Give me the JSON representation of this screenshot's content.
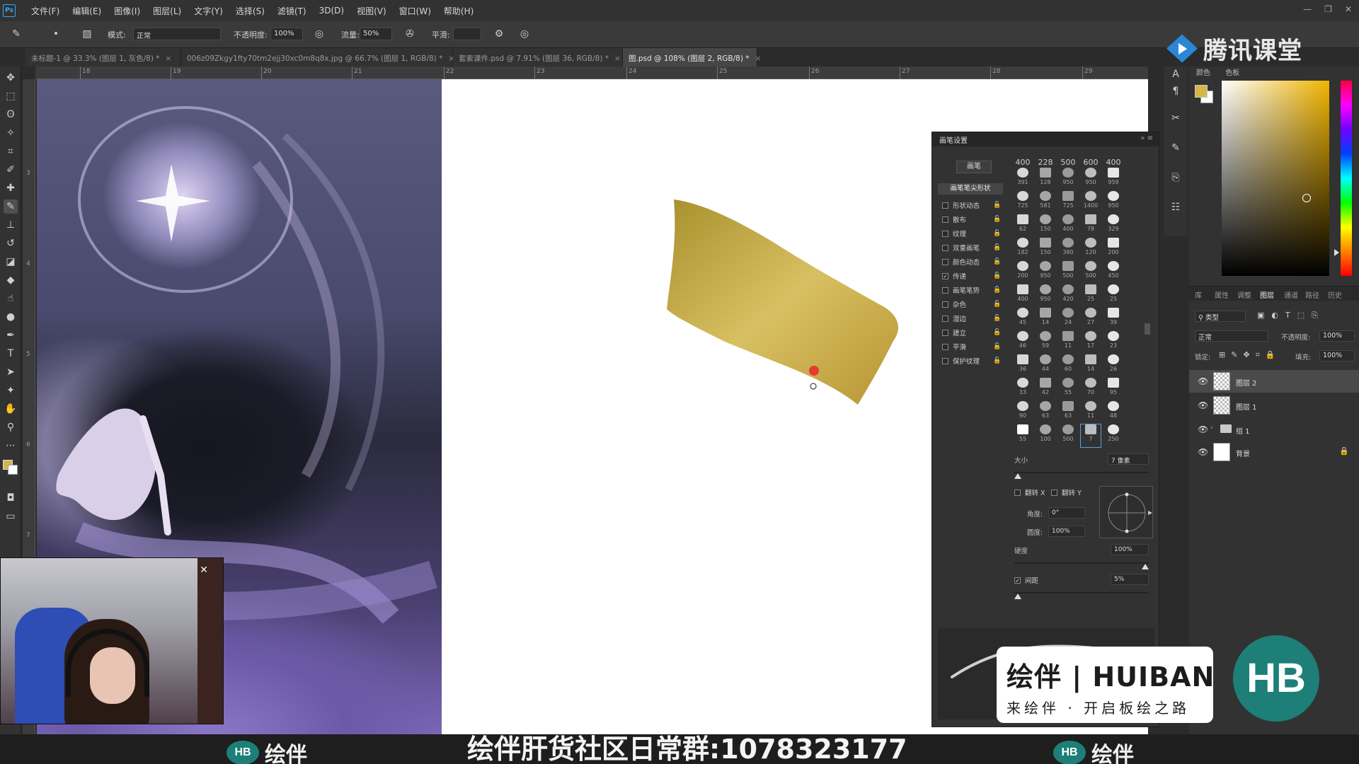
{
  "app": {
    "logo": "Ps"
  },
  "menu": [
    "文件(F)",
    "编辑(E)",
    "图像(I)",
    "图层(L)",
    "文字(Y)",
    "选择(S)",
    "滤镜(T)",
    "3D(D)",
    "视图(V)",
    "窗口(W)",
    "帮助(H)"
  ],
  "options": {
    "mode_label": "模式:",
    "mode_value": "正常",
    "opacity_label": "不透明度:",
    "opacity_value": "100%",
    "flow_label": "流量:",
    "flow_value": "50%",
    "smoothing_label": "平滑:"
  },
  "tabs": [
    {
      "label": "未标题-1 @ 33.3% (图层 1, 灰色/8) *"
    },
    {
      "label": "006z09Zkgy1fty70tm2ejj30xc0m8q8x.jpg @ 66.7% (图层 1, RGB/8) *"
    },
    {
      "label": "套索课件.psd @ 7.91% (图层 36, RGB/8) *"
    },
    {
      "label": "图.psd @ 108% (图层 2, RGB/8) *"
    }
  ],
  "ruler_top": [
    "18",
    "19",
    "20",
    "21",
    "22",
    "23",
    "24",
    "25",
    "26",
    "27",
    "28",
    "29"
  ],
  "ruler_left": [
    "3",
    "4",
    "5",
    "6",
    "7"
  ],
  "brush_panel": {
    "title": "画笔设置",
    "brushes_button": "画笔",
    "tip_shape": "画笔笔尖形状",
    "options": [
      {
        "label": "形状动态",
        "checked": false
      },
      {
        "label": "散布",
        "checked": false
      },
      {
        "label": "纹理",
        "checked": false
      },
      {
        "label": "双重画笔",
        "checked": false
      },
      {
        "label": "颜色动态",
        "checked": false
      },
      {
        "label": "传递",
        "checked": true
      },
      {
        "label": "画笔笔势",
        "checked": false
      },
      {
        "label": "杂色",
        "checked": false
      },
      {
        "label": "湿边",
        "checked": false
      },
      {
        "label": "建立",
        "checked": false
      },
      {
        "label": "平滑",
        "checked": false
      },
      {
        "label": "保护纹理",
        "checked": false
      }
    ],
    "preset_top": [
      "400",
      "228",
      "500",
      "600",
      "400"
    ],
    "preset_sizes": [
      "391",
      "128",
      "950",
      "950",
      "959",
      "725",
      "581",
      "725",
      "1400",
      "950",
      "62",
      "150",
      "400",
      "78",
      "329",
      "182",
      "150",
      "380",
      "120",
      "200",
      "200",
      "950",
      "500",
      "500",
      "450",
      "400",
      "950",
      "420",
      "25",
      "25",
      "45",
      "14",
      "24",
      "27",
      "39",
      "46",
      "59",
      "11",
      "17",
      "23",
      "36",
      "44",
      "60",
      "14",
      "26",
      "33",
      "42",
      "55",
      "70",
      "95",
      "90",
      "63",
      "63",
      "11",
      "48",
      "55",
      "100",
      "500",
      "7",
      "250"
    ],
    "size_label": "大小",
    "size_value": "7 像素",
    "flip_x": "翻转 X",
    "flip_y": "翻转 Y",
    "angle_label": "角度:",
    "angle_value": "0°",
    "roundness_label": "圆度:",
    "roundness_value": "100%",
    "hardness_label": "硬度",
    "hardness_value": "100%",
    "spacing_label": "间距",
    "spacing_value": "5%"
  },
  "color_panel": {
    "tabs": [
      "颜色",
      "色板"
    ],
    "foreground": "#d5b64a",
    "background": "#ffffff"
  },
  "layers_panel": {
    "tabs": [
      "库",
      "属性",
      "调整",
      "图层",
      "通道",
      "路径",
      "历史"
    ],
    "filter_kind": "类型",
    "blend_mode": "正常",
    "opacity_label": "不透明度:",
    "opacity_value": "100%",
    "lock_label": "锁定:",
    "fill_label": "填充:",
    "fill_value": "100%",
    "layers": [
      {
        "name": "图层 2",
        "active": true,
        "kind": "layer"
      },
      {
        "name": "图层 1",
        "active": false,
        "kind": "layer"
      },
      {
        "name": "组 1",
        "active": false,
        "kind": "group"
      },
      {
        "name": "背景",
        "active": false,
        "kind": "background"
      }
    ]
  },
  "watermarks": {
    "tencent": "腾讯课堂",
    "huiban_line1": "绘伴 | HUIBAN",
    "huiban_line2": "来绘伴 · 开启板绘之路",
    "hb": "HB"
  },
  "footer": {
    "left_logo": "HB",
    "left_text": "绘伴",
    "center": "绘伴肝货社区日常群:1078323177",
    "right_logo": "HB",
    "right_text": "绘伴"
  },
  "colors": {
    "accent": "#31a8ff",
    "brand_green": "#1d7f78",
    "stroke_gold": "#c9a63a"
  }
}
